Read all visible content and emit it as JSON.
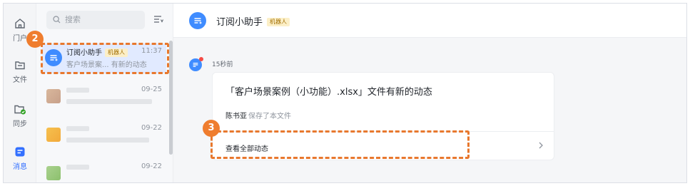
{
  "rail": {
    "items": [
      {
        "label": "门户",
        "icon": "home-icon"
      },
      {
        "label": "文件",
        "icon": "file-icon"
      },
      {
        "label": "同步",
        "icon": "sync-folder-icon"
      },
      {
        "label": "消息",
        "icon": "message-icon",
        "active": true
      }
    ]
  },
  "list": {
    "search_placeholder": "搜索",
    "conversations": [
      {
        "name": "订阅小助手",
        "badge": "机器人",
        "time": "11:37",
        "preview": "客户场景案... 有新的动态"
      },
      {
        "time": "09-25"
      },
      {
        "time": "09-22"
      },
      {
        "time": "09-22"
      }
    ]
  },
  "main": {
    "title": "订阅小助手",
    "badge": "机器人",
    "message": {
      "time": "15秒前",
      "card_title": "「客户场景案例（小功能）.xlsx」文件有新的动态",
      "user": "陈书亚",
      "action": "保存了本文件",
      "link": "查看全部动态"
    }
  },
  "callouts": [
    "2",
    "3"
  ],
  "colors": {
    "accent": "#3370ff",
    "callout": "#ef7d2e",
    "robot_badge_bg": "#fcefc7"
  }
}
